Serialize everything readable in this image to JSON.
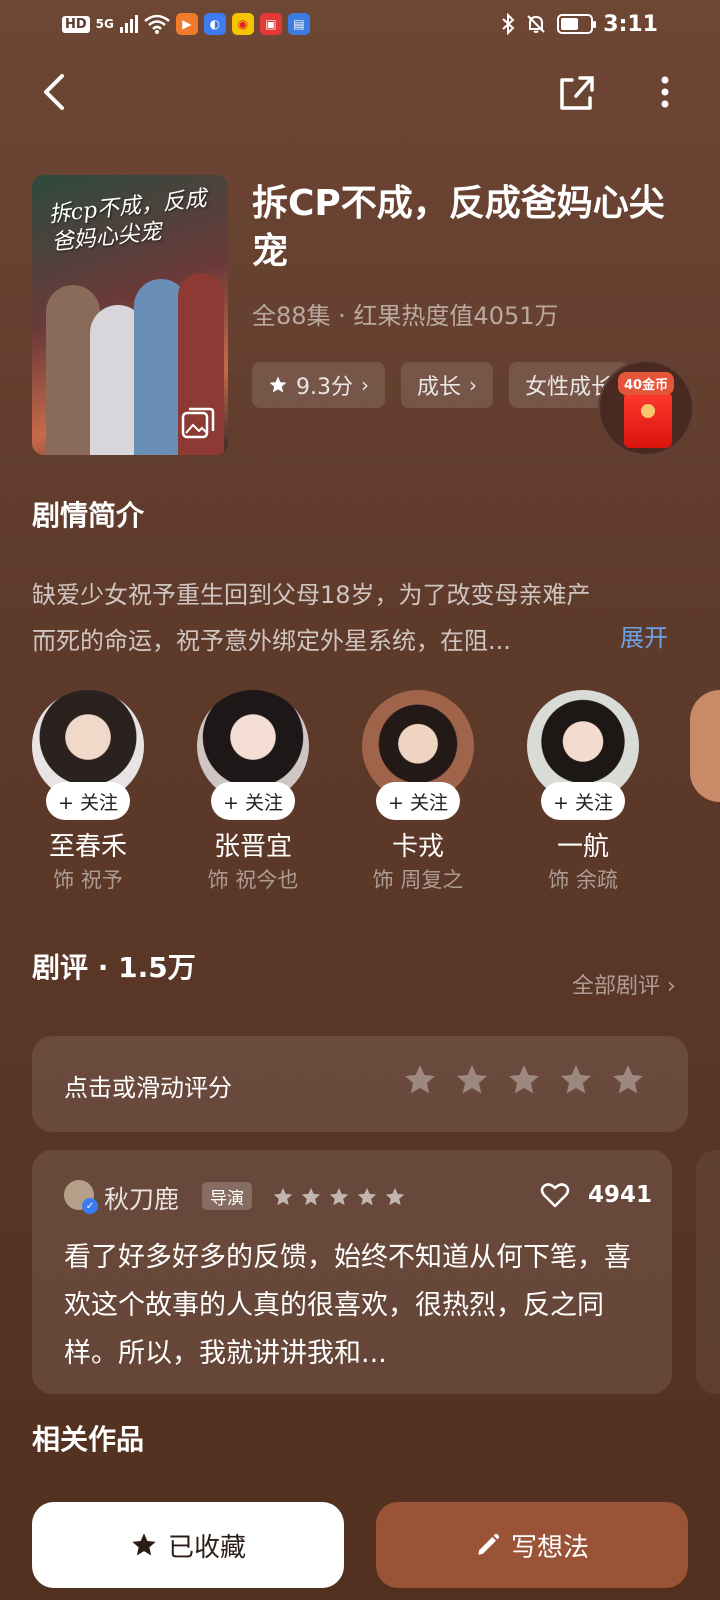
{
  "status_bar": {
    "hd": "HD",
    "network": "5G",
    "time": "3:11",
    "battery_level": 0.6,
    "icons": [
      "hd-icon",
      "signal-icon",
      "wifi-icon",
      "video-app-icon",
      "safari-app-icon",
      "weibo-app-icon",
      "red-app-icon",
      "blue-app-icon",
      "bluetooth-icon",
      "mute-icon",
      "battery-icon"
    ]
  },
  "nav": {
    "icons": [
      "back-icon",
      "share-icon",
      "more-icon"
    ]
  },
  "drama": {
    "poster_title": "拆cp不成，反成爸妈心尖宠",
    "title": "拆CP不成，反成爸妈心尖宠",
    "meta": "全88集 · 红果热度值4051万",
    "rating_tag": "9.3分",
    "tags": [
      "成长",
      "女性成长"
    ]
  },
  "coin_badge": {
    "label": "40金币"
  },
  "synopsis": {
    "section_title": "剧情简介",
    "text": "缺爱少女祝予重生回到父母18岁，为了改变母亲难产而死的命运，祝予意外绑定外星系统，在阻...",
    "expand_label": "展开"
  },
  "cast": [
    {
      "follow_label": "+ 关注",
      "name": "至春禾",
      "role": "饰 祝予"
    },
    {
      "follow_label": "+ 关注",
      "name": "张晋宜",
      "role": "饰 祝今也"
    },
    {
      "follow_label": "+ 关注",
      "name": "卡戎",
      "role": "饰 周复之"
    },
    {
      "follow_label": "+ 关注",
      "name": "一航",
      "role": "饰 余疏"
    }
  ],
  "reviews": {
    "section_title": "剧评 · 1.5万",
    "all_label": "全部剧评",
    "rate_prompt": "点击或滑动评分",
    "rate_stars": 5,
    "featured": {
      "author": "秋刀鹿",
      "role_badge": "导演",
      "stars": 5,
      "likes": "4941",
      "text": "看了好多好多的反馈，始终不知道从何下笔，喜欢这个故事的人真的很喜欢，很热烈，反之同样。所以，我就讲讲我和..."
    }
  },
  "related": {
    "section_title": "相关作品"
  },
  "bottom_bar": {
    "favorite_label": "已收藏",
    "write_label": "写想法"
  },
  "colors": {
    "background": "#5e3a2b",
    "accent_link": "#6ea2e6",
    "write_button": "#9a5336",
    "favorite_button": "#ffffff"
  }
}
